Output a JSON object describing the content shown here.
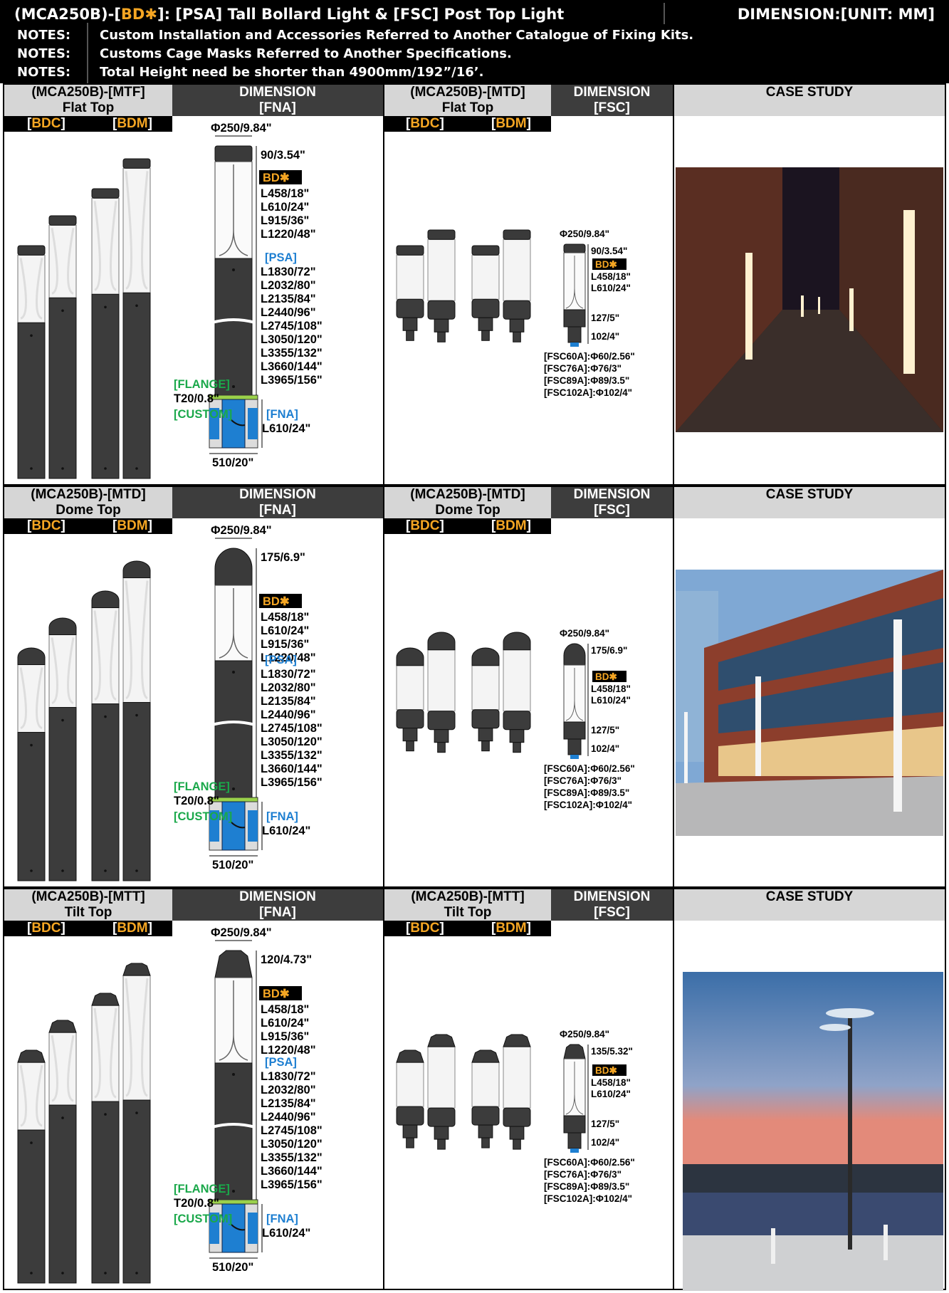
{
  "header": {
    "title_prefix": "(MCA250B)-[",
    "title_code": "BD",
    "title_rest": "]: [PSA] Tall Bollard Light & [FSC] Post Top Light",
    "unit": "DIMENSION:[UNIT: MM]",
    "notes_label": "NOTES:",
    "notes": [
      "Custom Installation and Accessories Referred to Another Catalogue of Fixing Kits.",
      "Customs Cage Masks Referred to Another Specifications.",
      "Total Height need be shorter than 4900mm/192”/16’."
    ]
  },
  "tags": {
    "bdc": "BDC",
    "bdm": "BDM",
    "bd_star": "BD✱"
  },
  "sections": [
    {
      "model": "(MCA250B)-[MTF]",
      "top": "Flat Top",
      "model_fsc": "(MCA250B)-[MTD]",
      "top_fsc": "Flat Top",
      "dim_fna": [
        "DIMENSION",
        "[FNA]"
      ],
      "dim_fsc": [
        "DIMENSION",
        "[FSC]"
      ],
      "case": "CASE STUDY",
      "diameter": "Φ250/9.84\"",
      "cap_h": "90/3.54\"",
      "cap_h_fsc": "90/3.54\""
    },
    {
      "model": "(MCA250B)-[MTD]",
      "top": "Dome Top",
      "model_fsc": "(MCA250B)-[MTD]",
      "top_fsc": "Dome Top",
      "dim_fna": [
        "DIMENSION",
        "[FNA]"
      ],
      "dim_fsc": [
        "DIMENSION",
        "[FSC]"
      ],
      "case": "CASE STUDY",
      "diameter": "Φ250/9.84\"",
      "cap_h": "175/6.9\"",
      "cap_h_fsc": "175/6.9\""
    },
    {
      "model": "(MCA250B)-[MTT]",
      "top": "Tilt Top",
      "model_fsc": "(MCA250B)-[MTT]",
      "top_fsc": "Tilt Top",
      "dim_fna": [
        "DIMENSION",
        "[FNA]"
      ],
      "dim_fsc": [
        "DIMENSION",
        "[FSC]"
      ],
      "case": "CASE STUDY",
      "diameter": "Φ250/9.84\"",
      "cap_h": "120/4.73\"",
      "cap_h_fsc": "135/5.32\""
    }
  ],
  "fna": {
    "bd_lengths": [
      "L458/18\"",
      "L610/24\"",
      "L915/36\"",
      "L1220/48\""
    ],
    "psa": "[PSA]",
    "psa_lengths": [
      "L1830/72\"",
      "L2032/80\"",
      "L2135/84\"",
      "L2440/96\"",
      "L2745/108\"",
      "L3050/120\"",
      "L3355/132\"",
      "L3660/144\"",
      "L3965/156\""
    ],
    "flange": "[FLANGE]",
    "flange_t": "T20/0.8\"",
    "custom": "[CUSTOM]",
    "fna_tag": "[FNA]",
    "fna_len": "L610/24\"",
    "base": "510/20\""
  },
  "fsc": {
    "lengths": [
      "L458/18\"",
      "L610/24\""
    ],
    "h1": "127/5\"",
    "h2": "102/4\"",
    "options": [
      "[FSC60A]:Φ60/2.56\"",
      "[FSC76A]:Φ76/3\"",
      "[FSC89A]:Φ89/3.5\"",
      "[FSC102A]:Φ102/4\""
    ]
  },
  "colors": {
    "accent": "#f5a623",
    "blue": "#1e7fd1",
    "green": "#1aa84a",
    "dark": "#3d3d3d",
    "gray": "#d6d6d6"
  }
}
